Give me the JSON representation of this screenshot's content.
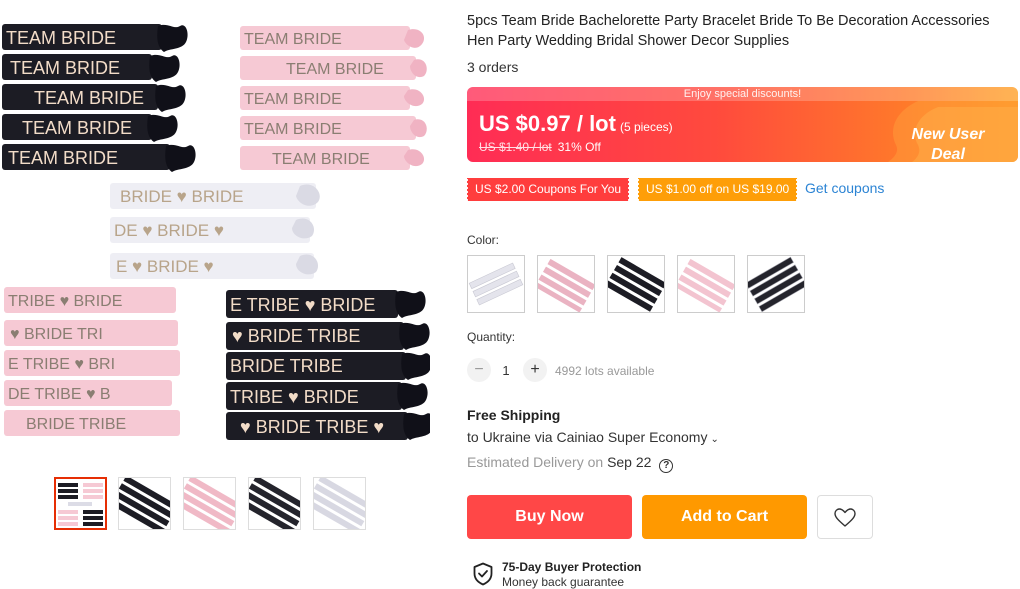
{
  "product": {
    "title": "5pcs Team Bride Bachelorette Party Bracelet Bride To Be Decoration Accessories Hen Party Wedding Bridal Shower Decor Supplies",
    "orders": "3 orders"
  },
  "gallery": {
    "main_image_label": "main-product-image",
    "thumbnails": [
      {
        "name": "thumbnail-1",
        "active": true
      },
      {
        "name": "thumbnail-2",
        "active": false
      },
      {
        "name": "thumbnail-3",
        "active": false
      },
      {
        "name": "thumbnail-4",
        "active": false
      },
      {
        "name": "thumbnail-5",
        "active": false
      }
    ],
    "band_text": {
      "team_bride": "TEAM BRIDE",
      "bride": "BRIDE",
      "bride_tribe": "BRIDE TRIBE"
    }
  },
  "price": {
    "banner": "Enjoy special discounts!",
    "current": "US $0.97 / lot",
    "pieces": "(5 pieces)",
    "original": "US $1.40 / lot",
    "discount": "31% Off",
    "deal_line1": "New User",
    "deal_line2": "Deal"
  },
  "coupons": {
    "coupon1": "US $2.00 Coupons For You",
    "coupon2": "US $1.00 off on US $19.00",
    "get_link": "Get coupons"
  },
  "color": {
    "label": "Color:",
    "options": [
      "white",
      "pink",
      "black",
      "light-pink",
      "black-silver"
    ]
  },
  "quantity": {
    "label": "Quantity:",
    "minus": "−",
    "plus": "+",
    "value": "1",
    "available": "4992 lots available"
  },
  "shipping": {
    "title": "Free Shipping",
    "to": "to Ukraine via Cainiao Super Economy",
    "chevron": "⌄",
    "estimate_prefix": "Estimated Delivery on",
    "estimate_date": "Sep 22",
    "help": "?"
  },
  "actions": {
    "buy_now": "Buy Now",
    "add_to_cart": "Add to Cart"
  },
  "protection": {
    "title": "75-Day Buyer Protection",
    "subtitle": "Money back guarantee"
  },
  "colors": {
    "accent_red": "#ff4747",
    "accent_orange": "#ff9900",
    "link_blue": "#2c84d4",
    "band_black": "#1c1c24",
    "band_pink": "#f6c9d4",
    "band_white": "#eeeef4"
  }
}
